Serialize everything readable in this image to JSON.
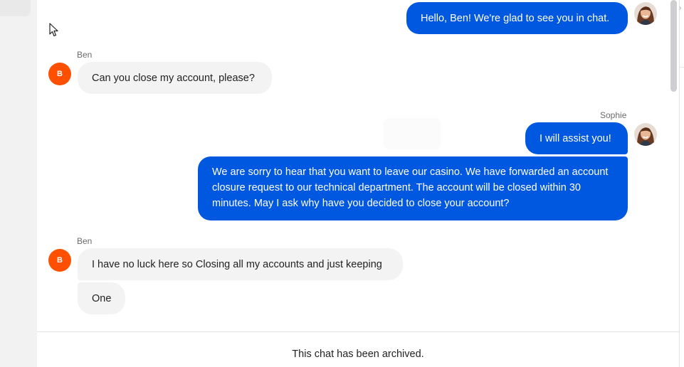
{
  "chat": {
    "messages": [
      {
        "sender": "Sophie",
        "side": "out",
        "text": "Hello, Ben! We're glad to see you in chat."
      },
      {
        "sender": "Ben",
        "side": "in",
        "show_name": "Ben",
        "text": "Can you close my account, please?"
      },
      {
        "sender": "Sophie",
        "side": "out",
        "show_name": "Sophie",
        "text": "I will assist you!"
      },
      {
        "sender": "Sophie",
        "side": "out",
        "text": "We are sorry to hear that you want to leave our casino. We have forwarded an account closure request to our technical department. The account will be closed within 30 minutes. May I ask why have you decided to close your account?"
      },
      {
        "sender": "Ben",
        "side": "in",
        "show_name": "Ben",
        "text": "I have no luck here so Closing all my accounts and just keeping"
      },
      {
        "sender": "Ben",
        "side": "in",
        "text": "One"
      }
    ],
    "ben_avatar_initial": "B",
    "archived_notice": "This chat has been archived."
  },
  "colors": {
    "agent_bubble": "#0057e0",
    "customer_bubble": "#f3f3f4",
    "customer_avatar": "#fe5000"
  },
  "icons": {
    "cursor": "mouse-pointer-icon",
    "agent_avatar": "agent-photo-avatar"
  }
}
